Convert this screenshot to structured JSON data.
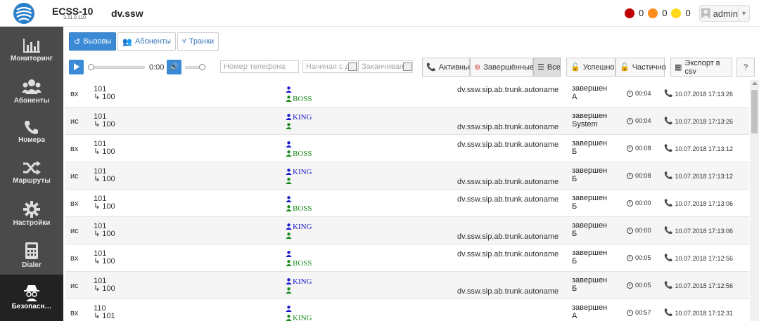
{
  "header": {
    "app_name": "ECSS-10",
    "version": "3.11.0.110",
    "domain": "dv.ssw",
    "alarms": [
      {
        "color": "#c00000",
        "count": "0"
      },
      {
        "color": "#ff8c1a",
        "count": "0"
      },
      {
        "color": "#ffd81a",
        "count": "0"
      }
    ],
    "user": "admin"
  },
  "sidebar": {
    "items": [
      {
        "label": "Мониторинг",
        "icon": "bar-chart-icon"
      },
      {
        "label": "Абоненты",
        "icon": "users-icon"
      },
      {
        "label": "Номера",
        "icon": "phone-icon"
      },
      {
        "label": "Маршруты",
        "icon": "shuffle-icon"
      },
      {
        "label": "Настройки",
        "icon": "gear-icon"
      },
      {
        "label": "Dialer",
        "icon": "dialer-icon"
      },
      {
        "label": "Безопасн…",
        "icon": "spy-icon"
      }
    ]
  },
  "tabs": [
    {
      "label": "Вызовы",
      "icon": "history-icon"
    },
    {
      "label": "Абоненты",
      "icon": "users-icon"
    },
    {
      "label": "Транки",
      "icon": "trunk-icon"
    }
  ],
  "player": {
    "time": "0:00",
    "progress": 0.0
  },
  "filters": {
    "phone_placeholder": "Номер телефона",
    "start_placeholder": "Начиная с д",
    "end_placeholder": "Заканчивая",
    "active_label": "Активный",
    "finished_label": "Завершённые",
    "all_label": "Все",
    "success_label": "Успешно",
    "partial_label": "Частично",
    "export_label": "Экспорт в csv",
    "help_label": "?"
  },
  "calls": [
    {
      "dir": "вх",
      "from": "101",
      "to": "100",
      "party1": "",
      "party2": "BOSS",
      "trunk": "dv.ssw.sip.ab.trunk.autoname",
      "trunk_line": 1,
      "status1": "завершен",
      "status2": "А",
      "duration": "00:04",
      "date": "10.07.2018 17:13:26"
    },
    {
      "dir": "ис",
      "from": "101",
      "to": "100",
      "party1": "KING",
      "party2": "",
      "trunk": "dv.ssw.sip.ab.trunk.autoname",
      "trunk_line": 2,
      "status1": "завершен",
      "status2": "System",
      "duration": "00:04",
      "date": "10.07.2018 17:13:26"
    },
    {
      "dir": "вх",
      "from": "101",
      "to": "100",
      "party1": "",
      "party2": "BOSS",
      "trunk": "dv.ssw.sip.ab.trunk.autoname",
      "trunk_line": 1,
      "status1": "завершен",
      "status2": "Б",
      "duration": "00:08",
      "date": "10.07.2018 17:13:12"
    },
    {
      "dir": "ис",
      "from": "101",
      "to": "100",
      "party1": "KING",
      "party2": "",
      "trunk": "dv.ssw.sip.ab.trunk.autoname",
      "trunk_line": 2,
      "status1": "завершен",
      "status2": "Б",
      "duration": "00:08",
      "date": "10.07.2018 17:13:12"
    },
    {
      "dir": "вх",
      "from": "101",
      "to": "100",
      "party1": "",
      "party2": "BOSS",
      "trunk": "dv.ssw.sip.ab.trunk.autoname",
      "trunk_line": 1,
      "status1": "завершен",
      "status2": "Б",
      "duration": "00:00",
      "date": "10.07.2018 17:13:06"
    },
    {
      "dir": "ис",
      "from": "101",
      "to": "100",
      "party1": "KING",
      "party2": "",
      "trunk": "dv.ssw.sip.ab.trunk.autoname",
      "trunk_line": 2,
      "status1": "завершен",
      "status2": "Б",
      "duration": "00:00",
      "date": "10.07.2018 17:13:06"
    },
    {
      "dir": "вх",
      "from": "101",
      "to": "100",
      "party1": "",
      "party2": "BOSS",
      "trunk": "dv.ssw.sip.ab.trunk.autoname",
      "trunk_line": 1,
      "status1": "завершен",
      "status2": "Б",
      "duration": "00:05",
      "date": "10.07.2018 17:12:56"
    },
    {
      "dir": "ис",
      "from": "101",
      "to": "100",
      "party1": "KING",
      "party2": "",
      "trunk": "dv.ssw.sip.ab.trunk.autoname",
      "trunk_line": 2,
      "status1": "завершен",
      "status2": "Б",
      "duration": "00:05",
      "date": "10.07.2018 17:12:56"
    },
    {
      "dir": "вх",
      "from": "110",
      "to": "101",
      "party1": "",
      "party2": "KING",
      "trunk": "",
      "trunk_line": 1,
      "status1": "завершен",
      "status2": "А",
      "duration": "00:57",
      "date": "10.07.2018 17:12:31"
    }
  ],
  "colors": {
    "accent": "#3a8ad6",
    "sidebar": "#4a4a4a",
    "party_blue": "#1a1acc",
    "party_green": "#1a8a1a"
  }
}
